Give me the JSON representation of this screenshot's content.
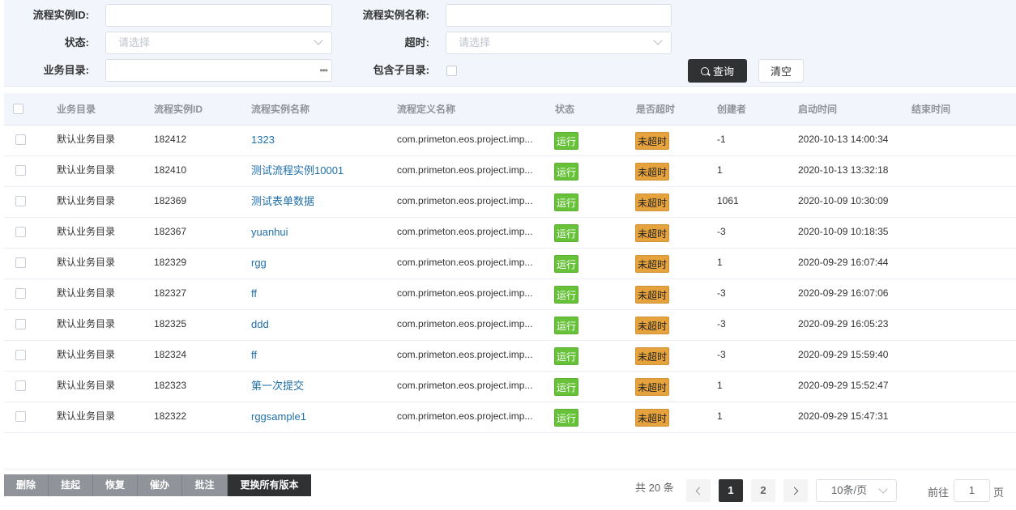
{
  "filters": {
    "instance_id_label": "流程实例ID:",
    "instance_id_value": "",
    "instance_name_label": "流程实例名称:",
    "instance_name_value": "",
    "status_label": "状态:",
    "status_placeholder": "请选择",
    "timeout_label": "超时:",
    "timeout_placeholder": "请选择",
    "catalog_label": "业务目录:",
    "catalog_value": "",
    "include_sub_label": "包含子目录:",
    "query_button": "查询",
    "clear_button": "清空"
  },
  "table": {
    "columns": [
      "业务目录",
      "流程实例ID",
      "流程实例名称",
      "流程定义名称",
      "状态",
      "是否超时",
      "创建者",
      "启动时间",
      "结束时间"
    ],
    "rows": [
      {
        "catalog": "默认业务目录",
        "id": "182412",
        "name": "1323",
        "def": "com.primeton.eos.project.imp...",
        "status": "运行",
        "timeout": "未超时",
        "creator": "-1",
        "start": "2020-10-13 14:00:34",
        "end": ""
      },
      {
        "catalog": "默认业务目录",
        "id": "182410",
        "name": "测试流程实例10001",
        "def": "com.primeton.eos.project.imp...",
        "status": "运行",
        "timeout": "未超时",
        "creator": "1",
        "start": "2020-10-13 13:32:18",
        "end": ""
      },
      {
        "catalog": "默认业务目录",
        "id": "182369",
        "name": "测试表单数据",
        "def": "com.primeton.eos.project.imp...",
        "status": "运行",
        "timeout": "未超时",
        "creator": "1061",
        "start": "2020-10-09 10:30:09",
        "end": ""
      },
      {
        "catalog": "默认业务目录",
        "id": "182367",
        "name": "yuanhui",
        "def": "com.primeton.eos.project.imp...",
        "status": "运行",
        "timeout": "未超时",
        "creator": "-3",
        "start": "2020-10-09 10:18:35",
        "end": ""
      },
      {
        "catalog": "默认业务目录",
        "id": "182329",
        "name": "rgg",
        "def": "com.primeton.eos.project.imp...",
        "status": "运行",
        "timeout": "未超时",
        "creator": "1",
        "start": "2020-09-29 16:07:44",
        "end": ""
      },
      {
        "catalog": "默认业务目录",
        "id": "182327",
        "name": "ff",
        "def": "com.primeton.eos.project.imp...",
        "status": "运行",
        "timeout": "未超时",
        "creator": "-3",
        "start": "2020-09-29 16:07:06",
        "end": ""
      },
      {
        "catalog": "默认业务目录",
        "id": "182325",
        "name": "ddd",
        "def": "com.primeton.eos.project.imp...",
        "status": "运行",
        "timeout": "未超时",
        "creator": "-3",
        "start": "2020-09-29 16:05:23",
        "end": ""
      },
      {
        "catalog": "默认业务目录",
        "id": "182324",
        "name": "ff",
        "def": "com.primeton.eos.project.imp...",
        "status": "运行",
        "timeout": "未超时",
        "creator": "-3",
        "start": "2020-09-29 15:59:40",
        "end": ""
      },
      {
        "catalog": "默认业务目录",
        "id": "182323",
        "name": "第一次提交",
        "def": "com.primeton.eos.project.imp...",
        "status": "运行",
        "timeout": "未超时",
        "creator": "1",
        "start": "2020-09-29 15:52:47",
        "end": ""
      },
      {
        "catalog": "默认业务目录",
        "id": "182322",
        "name": "rggsample1",
        "def": "com.primeton.eos.project.imp...",
        "status": "运行",
        "timeout": "未超时",
        "creator": "1",
        "start": "2020-09-29 15:47:31",
        "end": ""
      }
    ]
  },
  "actions": [
    "删除",
    "挂起",
    "恢复",
    "催办",
    "批注",
    "更换所有版本"
  ],
  "pagination": {
    "total_text": "共 20 条",
    "pages": [
      "1",
      "2"
    ],
    "current_page": "1",
    "page_size": "10条/页",
    "goto_prefix": "前往",
    "goto_value": "1",
    "goto_suffix": "页"
  },
  "colors": {
    "status_running": "#67c23a",
    "timeout_not": "#e6a23c",
    "primary_dark": "#2f3133",
    "link": "#1f6fa8"
  }
}
